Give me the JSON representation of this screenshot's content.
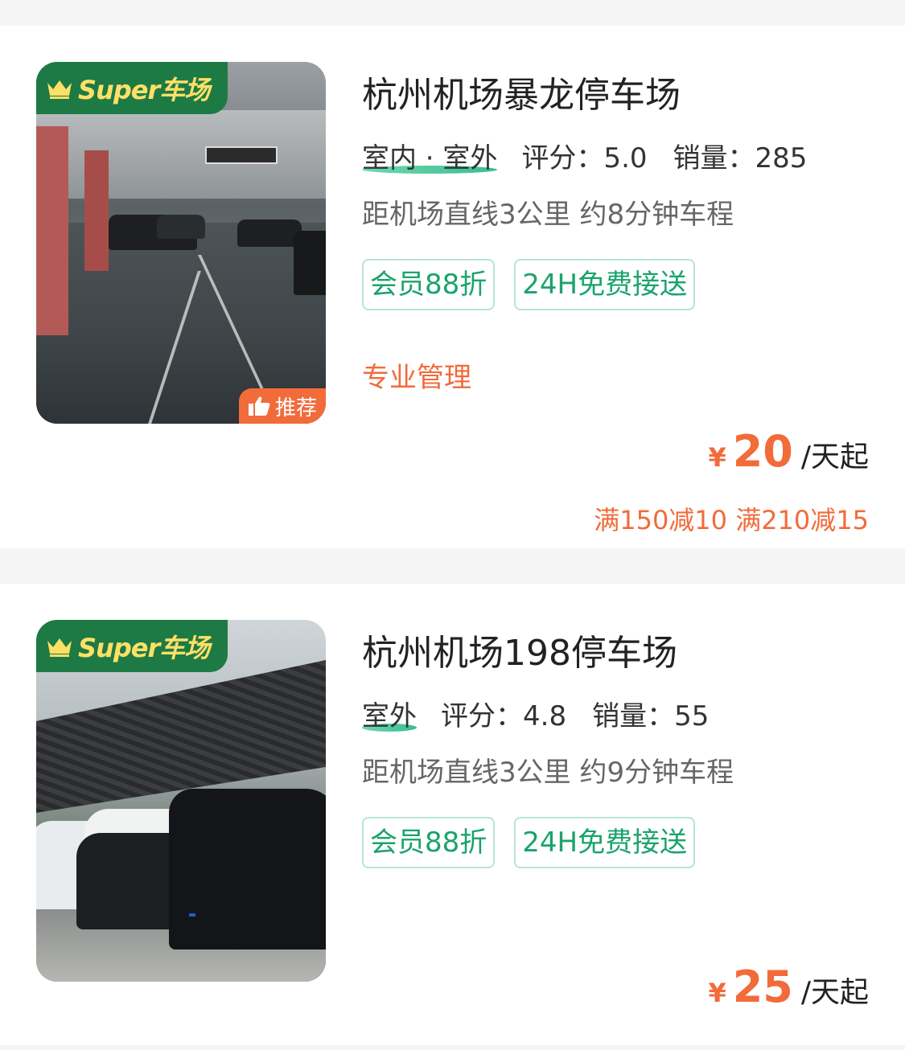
{
  "listings": [
    {
      "badge": "Super车场",
      "recommend": "推荐",
      "title": "杭州机场暴龙停车场",
      "type": "室内 · 室外",
      "rating_label": "评分：5.0",
      "sales_label": "销量：285",
      "distance": "距机场直线3公里 约8分钟车程",
      "tags": [
        "会员88折",
        "24H免费接送"
      ],
      "feature": "专业管理",
      "price_symbol": "¥",
      "price": "20",
      "price_unit": "/天起",
      "discount": "满150减10 满210减15"
    },
    {
      "badge": "Super车场",
      "title": "杭州机场198停车场",
      "type": "室外",
      "rating_label": "评分：4.8",
      "sales_label": "销量：55",
      "distance": "距机场直线3公里 约9分钟车程",
      "tags": [
        "会员88折",
        "24H免费接送"
      ],
      "price_symbol": "¥",
      "price": "25",
      "price_unit": "/天起"
    }
  ],
  "colors": {
    "accent_green": "#1d7a45",
    "tag_green": "#1aa36e",
    "price_orange": "#f26b3a",
    "badge_yellow": "#ffe066"
  },
  "icons": {
    "crown": "crown-icon",
    "thumb": "thumbs-up-icon"
  }
}
